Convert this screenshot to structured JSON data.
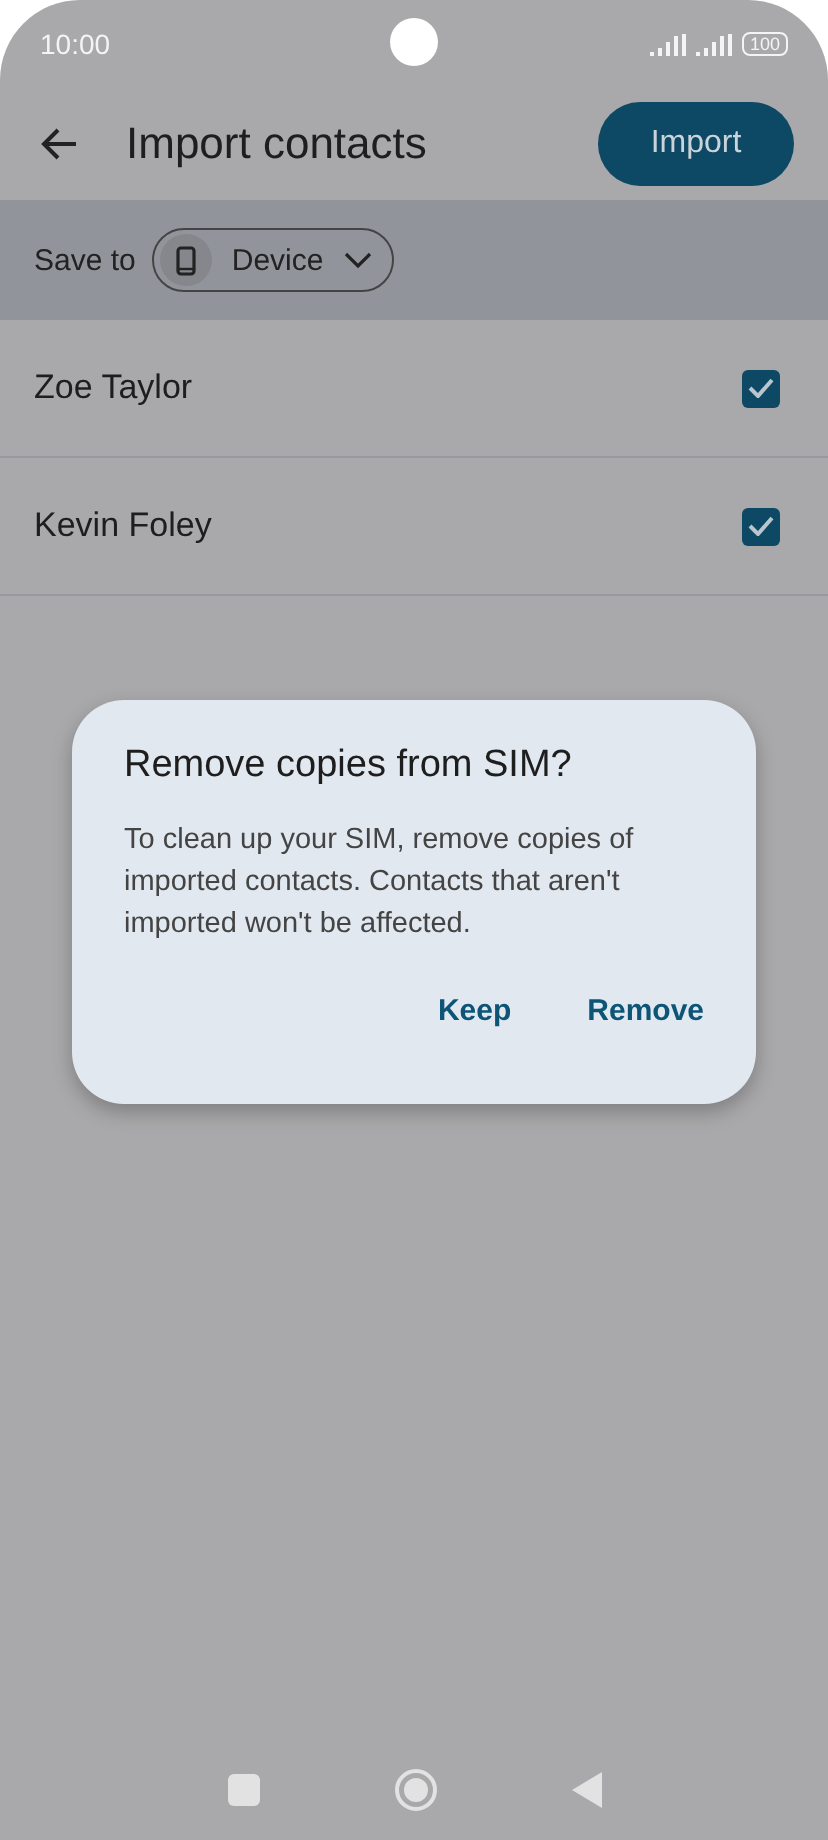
{
  "status_bar": {
    "time": "10:00",
    "battery": "100"
  },
  "app_bar": {
    "title": "Import contacts",
    "action": "Import"
  },
  "save_to": {
    "label": "Save to",
    "target": "Device"
  },
  "contacts": [
    {
      "name": "Zoe Taylor",
      "checked": true
    },
    {
      "name": "Kevin Foley",
      "checked": true
    }
  ],
  "dialog": {
    "title": "Remove copies from SIM?",
    "message": "To clean up your SIM, remove copies of imported contacts. Contacts that aren't imported won't be affected.",
    "buttons": [
      "Keep",
      "Remove"
    ]
  }
}
